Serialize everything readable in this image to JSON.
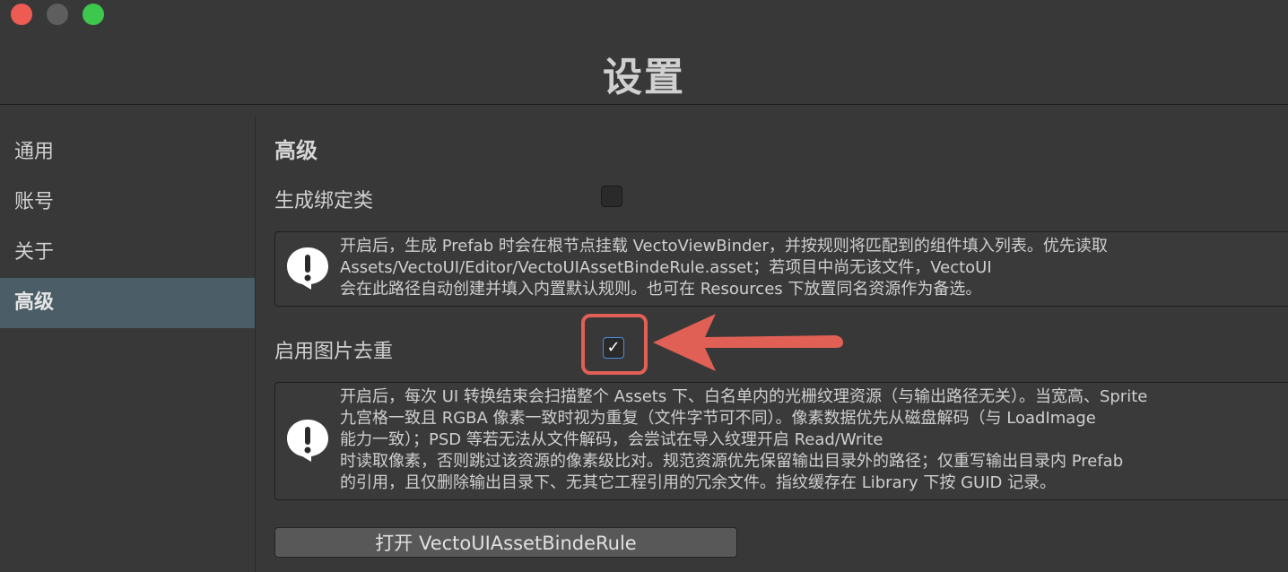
{
  "window": {
    "title": "设置"
  },
  "sidebar": {
    "items": [
      {
        "label": "通用"
      },
      {
        "label": "账号"
      },
      {
        "label": "关于"
      },
      {
        "label": "高级"
      }
    ],
    "active": "高级"
  },
  "main": {
    "section_title": "高级",
    "settings": [
      {
        "label": "生成绑定类",
        "checked": false,
        "help_lines": [
          "开启后，生成 Prefab 时会在根节点挂载 VectoViewBinder，并按规则将匹配到的组件填入列表。优先读取",
          "Assets/VectoUI/Editor/VectoUIAssetBindeRule.asset；若项目中尚无该文件，VectoUI",
          "会在此路径自动创建并填入内置默认规则。也可在 Resources 下放置同名资源作为备选。"
        ]
      },
      {
        "label": "启用图片去重",
        "checked": true,
        "check_glyph": "✓",
        "help_lines": [
          "开启后，每次 UI 转换结束会扫描整个 Assets 下、白名单内的光栅纹理资源（与输出路径无关）。当宽高、Sprite",
          "九宫格一致且 RGBA 像素一致时视为重复（文件字节可不同）。像素数据优先从磁盘解码（与 LoadImage",
          "能力一致）；PSD 等若无法从文件解码，会尝试在导入纹理开启 Read/Write",
          "时读取像素，否则跳过该资源的像素级比对。规范资源优先保留输出目录外的路径；仅重写输出目录内 Prefab",
          "的引用，且仅删除输出目录下、无其它工程引用的冗余文件。指纹缓存在 Library 下按 GUID 记录。"
        ]
      }
    ],
    "button_label": "打开 VectoUIAssetBindeRule"
  },
  "colors": {
    "background": "#383838",
    "sidebar_active": "#4b5d67",
    "annotation": "#e06055",
    "checkbox_accent": "#4c8be0"
  },
  "icons": {
    "help": "exclamation-speech-bubble-icon",
    "check": "checkmark-icon",
    "annotation_arrow": "arrow-left-icon"
  }
}
